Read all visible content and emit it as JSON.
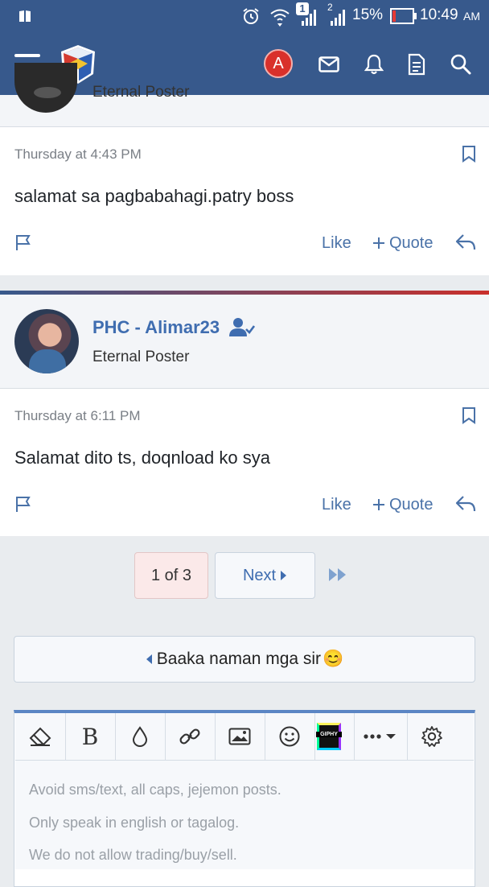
{
  "status_bar": {
    "sim1_badge": "1",
    "sim2_badge": "2",
    "battery": "15%",
    "time": "10:49",
    "ampm": "AM"
  },
  "navbar": {
    "avatar_letter": "A"
  },
  "posts": [
    {
      "author_title_partial": "Eternal Poster",
      "timestamp": "Thursday at 4:43 PM",
      "message": "salamat sa pagbabahagi.patry boss",
      "like": "Like",
      "quote": "Quote"
    },
    {
      "author": "PHC - Alimar23",
      "author_title": "Eternal Poster",
      "timestamp": "Thursday at 6:11 PM",
      "message": "Salamat dito ts, doqnload ko sya",
      "like": "Like",
      "quote": "Quote"
    }
  ],
  "pagination": {
    "current": "1 of 3",
    "next": "Next"
  },
  "thread_nav": {
    "prev_thread": "Baaka naman mga sir",
    "emoji": "😊"
  },
  "editor": {
    "toolbar": [
      "eraser-icon",
      "bold",
      "color-icon",
      "link-icon",
      "image-icon",
      "smilie-icon",
      "giphy-icon",
      "more-icon",
      "settings-icon"
    ],
    "bold_label": "B",
    "giphy_label": "GIPHY",
    "placeholder_lines": [
      "Avoid sms/text, all caps, jejemon posts.",
      "Only speak in english or tagalog.",
      "We do not allow trading/buy/sell."
    ]
  },
  "colors": {
    "header": "#37598c",
    "link": "#4a72a8",
    "alert_red": "#d9302b",
    "divider_red": "#c9302c"
  }
}
